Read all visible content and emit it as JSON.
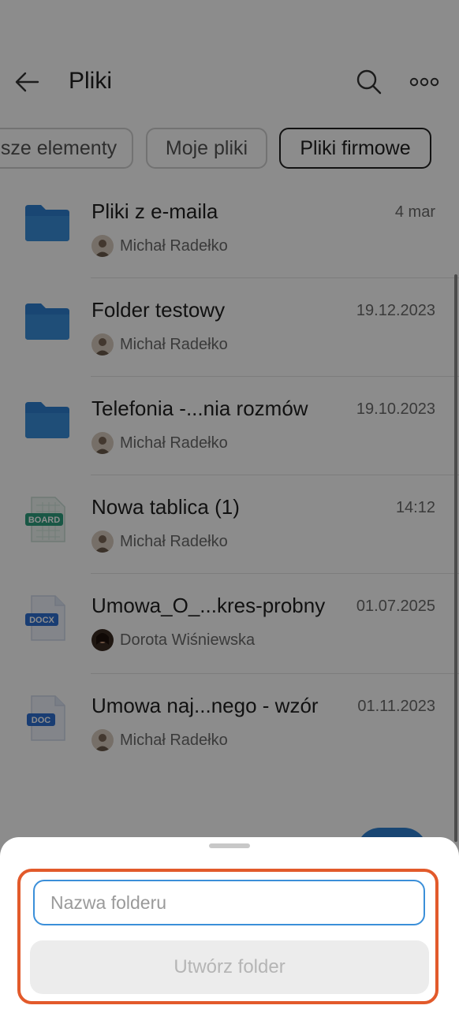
{
  "header": {
    "title": "Pliki",
    "back_icon": "arrow-left-icon",
    "search_icon": "search-icon",
    "more_icon": "more-horizontal-icon"
  },
  "filters": [
    {
      "label": "sze elementy",
      "active": false
    },
    {
      "label": "Moje pliki",
      "active": false
    },
    {
      "label": "Pliki firmowe",
      "active": true
    }
  ],
  "files": [
    {
      "title": "Pliki z e-maila",
      "date": "4 mar",
      "owner": "Michał Radełko",
      "type": "folder"
    },
    {
      "title": "Folder testowy",
      "date": "19.12.2023",
      "owner": "Michał Radełko",
      "type": "folder"
    },
    {
      "title": "Telefonia -...nia rozmów",
      "date": "19.10.2023",
      "owner": "Michał Radełko",
      "type": "folder"
    },
    {
      "title": "Nowa tablica (1)",
      "date": "14:12",
      "owner": "Michał Radełko",
      "type": "board",
      "badge": "BOARD"
    },
    {
      "title": "Umowa_O_...kres-probny",
      "date": "01.07.2025",
      "owner": "Dorota Wiśniewska",
      "type": "docx",
      "badge": "DOCX"
    },
    {
      "title": "Umowa naj...nego - wzór",
      "date": "01.11.2023",
      "owner": "Michał Radełko",
      "type": "doc",
      "badge": "DOC"
    }
  ],
  "sheet": {
    "input_placeholder": "Nazwa folderu",
    "input_value": "",
    "create_label": "Utwórz folder"
  },
  "colors": {
    "accent": "#3b8fd9",
    "folder": "#2f80d1",
    "highlight": "#e25a2b",
    "board": "#2e9e7e",
    "doc": "#2f6fd1"
  }
}
